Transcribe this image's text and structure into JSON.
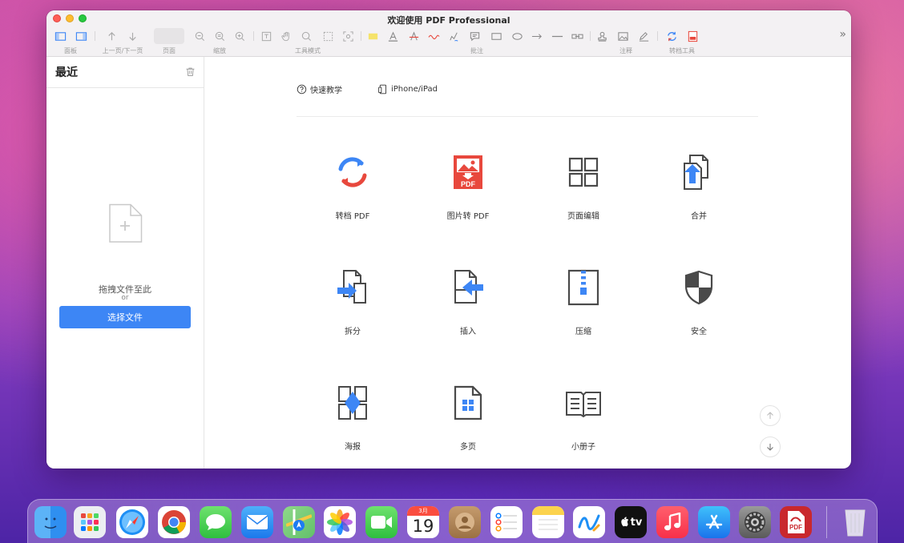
{
  "window": {
    "title": "欢迎使用 PDF Professional"
  },
  "toolbar": {
    "groups": {
      "panel": "面板",
      "prevnext": "上一页/下一页",
      "page": "页面",
      "zoom": "缩放",
      "toolmode": "工具模式",
      "annotate": "批注",
      "comment": "注释",
      "convert": "转档工具"
    },
    "more": "»"
  },
  "sidebar": {
    "title": "最近",
    "drop_text": "拖拽文件至此",
    "or_text": "or",
    "choose_button": "选择文件"
  },
  "main": {
    "links": [
      {
        "label": "快速教学",
        "icon": "question-circle-icon"
      },
      {
        "label": "iPhone/iPad",
        "icon": "device-icon"
      }
    ],
    "tools": [
      {
        "label": "转档 PDF",
        "icon": "convert-arrows-icon"
      },
      {
        "label": "图片转 PDF",
        "icon": "image-to-pdf-icon"
      },
      {
        "label": "页面编辑",
        "icon": "page-grid-icon"
      },
      {
        "label": "合并",
        "icon": "merge-icon"
      },
      {
        "label": "拆分",
        "icon": "split-icon"
      },
      {
        "label": "插入",
        "icon": "insert-icon"
      },
      {
        "label": "压缩",
        "icon": "compress-icon"
      },
      {
        "label": "安全",
        "icon": "shield-icon"
      },
      {
        "label": "海报",
        "icon": "poster-icon"
      },
      {
        "label": "多页",
        "icon": "multipage-icon"
      },
      {
        "label": "小册子",
        "icon": "booklet-icon"
      }
    ]
  },
  "dock": {
    "calendar_month": "3月",
    "calendar_day": "19",
    "tv_label": "tv",
    "pdf_label": "PDF",
    "apps": [
      "finder",
      "launchpad",
      "safari",
      "chrome",
      "messages",
      "mail",
      "maps",
      "photos",
      "facetime",
      "calendar",
      "contacts",
      "reminders",
      "notes",
      "freeform",
      "apple-tv",
      "music",
      "app-store",
      "system-settings",
      "pdf-professional",
      "trash"
    ]
  },
  "colors": {
    "accent": "#3d86f5",
    "pdf_red": "#e8483d",
    "icon_blue": "#3d86f5",
    "icon_gray": "#4a4a4a"
  }
}
